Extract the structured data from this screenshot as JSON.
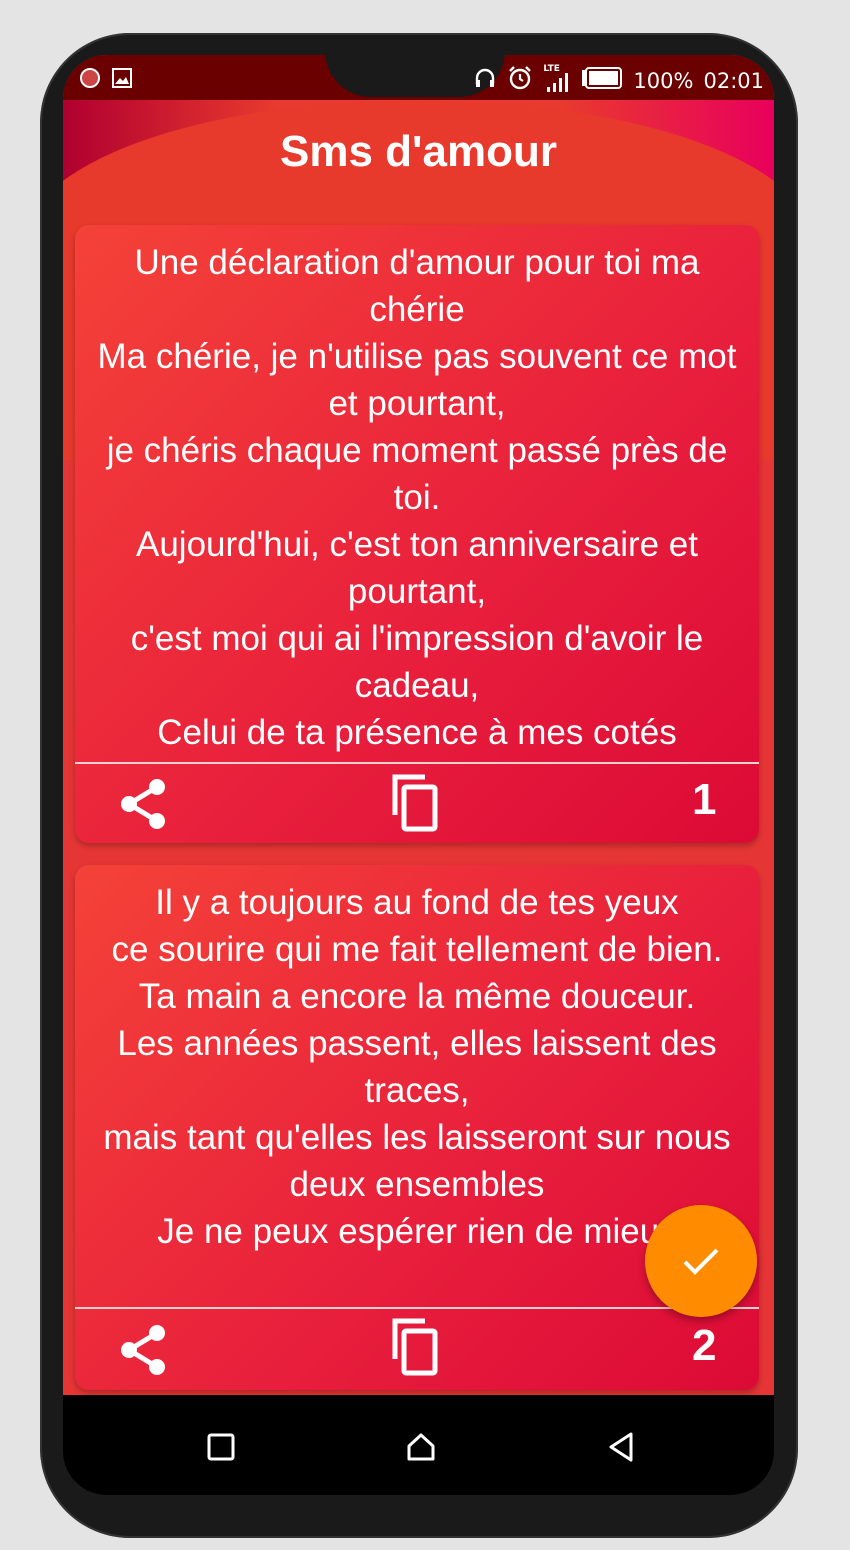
{
  "status_bar": {
    "lte": "LTE",
    "battery": "100%",
    "time": "02:01"
  },
  "app": {
    "title": "Sms d'amour"
  },
  "cards": [
    {
      "lines": [
        "Une déclaration d'amour pour toi ma chérie",
        "Ma chérie, je n'utilise pas souvent ce mot et pourtant,",
        "je chéris chaque moment passé près de toi.",
        "Aujourd'hui, c'est ton anniversaire et pourtant,",
        "c'est moi qui ai l'impression d'avoir le cadeau,",
        "Celui de ta présence à mes cotés"
      ],
      "number": "1"
    },
    {
      "lines": [
        "Il y a toujours au fond de tes yeux",
        "ce sourire qui me fait tellement de bien.",
        "Ta main a encore la même douceur.",
        "Les années passent, elles laissent des traces,",
        "mais tant qu'elles les laisseront sur nous deux ensembles",
        "Je ne peux espérer rien de mieux"
      ],
      "number": "2"
    }
  ],
  "colors": {
    "accent": "#ff8c00",
    "primary": "#e63535",
    "statusbar": "#6b0000"
  }
}
